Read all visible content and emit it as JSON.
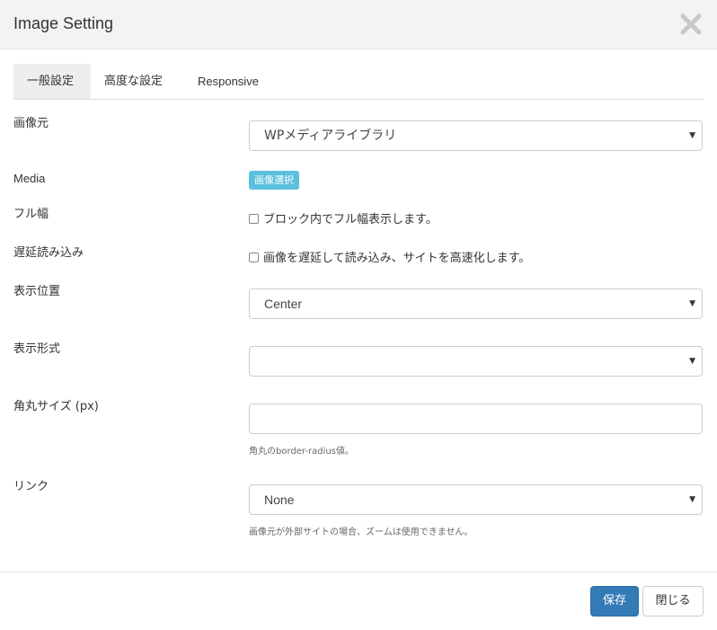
{
  "dialog": {
    "title": "Image Setting",
    "close_icon": "close-icon"
  },
  "tabs": [
    {
      "label": "一般設定",
      "active": true
    },
    {
      "label": "高度な設定",
      "active": false
    },
    {
      "label": "Responsive",
      "active": false
    }
  ],
  "fields": {
    "image_source": {
      "label": "画像元",
      "value": "WPメディアライブラリ"
    },
    "media": {
      "label": "Media",
      "button_label": "画像選択"
    },
    "full_width": {
      "label": "フル幅",
      "checkbox_label": "ブロック内でフル幅表示します。",
      "checked": false
    },
    "lazy_load": {
      "label": "遅延読み込み",
      "checkbox_label": "画像を遅延して読み込み、サイトを高速化します。",
      "checked": false
    },
    "display_position": {
      "label": "表示位置",
      "value": "Center"
    },
    "display_format": {
      "label": "表示形式",
      "value": ""
    },
    "border_radius": {
      "label": "角丸サイズ (px)",
      "value": "",
      "help": "角丸のborder-radius値。"
    },
    "link": {
      "label": "リンク",
      "value": "None",
      "help": "画像元が外部サイトの場合、ズームは使用できません。"
    }
  },
  "footer": {
    "save_label": "保存",
    "close_label": "閉じる"
  },
  "colors": {
    "primary": "#337ab7",
    "info": "#5bc0de",
    "header_bg": "#f3f3f3"
  }
}
